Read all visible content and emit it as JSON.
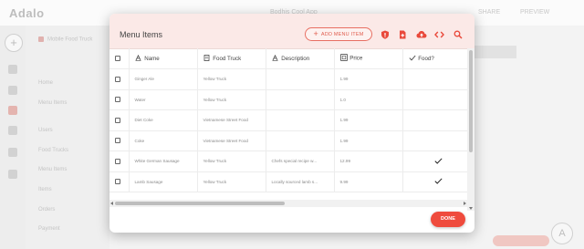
{
  "app": {
    "logo": "Adalo",
    "center_title": "Bodhis Cool App",
    "right_links": [
      "SHARE",
      "PREVIEW"
    ],
    "sidebar": [
      "Mobile Food Truck",
      "Home",
      "Menu Items",
      "Users",
      "Food Trucks",
      "Menu Items",
      "Items",
      "Orders",
      "Payment"
    ],
    "help": "A"
  },
  "modal": {
    "title": "Menu Items",
    "add_button": "ADD MENU ITEM",
    "header_icons": [
      "shield-icon",
      "add-document-icon",
      "cloud-upload-icon",
      "code-icon",
      "search-icon"
    ],
    "columns": [
      {
        "label": "Name",
        "icon": "text-icon"
      },
      {
        "label": "Food Truck",
        "icon": "document-icon"
      },
      {
        "label": "Description",
        "icon": "text-icon"
      },
      {
        "label": "Price",
        "icon": "number-icon"
      },
      {
        "label": "Food?",
        "icon": "checkmark-icon"
      }
    ],
    "rows": [
      {
        "name": "Ginger Ale",
        "truck": "Yellow Truck",
        "description": "",
        "price": "1.99",
        "food": false
      },
      {
        "name": "Water",
        "truck": "Yellow Truck",
        "description": "",
        "price": "1.0",
        "food": false
      },
      {
        "name": "Diet Coke",
        "truck": "Vietnamese Street Food",
        "description": "",
        "price": "1.99",
        "food": false
      },
      {
        "name": "Coke",
        "truck": "Vietnamese Street Food",
        "description": "",
        "price": "1.99",
        "food": false
      },
      {
        "name": "White German Sausage",
        "truck": "Yellow Truck",
        "description": "Chefs special recipe w...",
        "price": "12.99",
        "food": true
      },
      {
        "name": "Lamb Sausage",
        "truck": "Yellow Truck",
        "description": "Locally sourced lamb s...",
        "price": "9.99",
        "food": true
      }
    ],
    "done_button": "DONE"
  },
  "colors": {
    "accent": "#ef4b3d",
    "header_bg": "#fbe9e7"
  }
}
